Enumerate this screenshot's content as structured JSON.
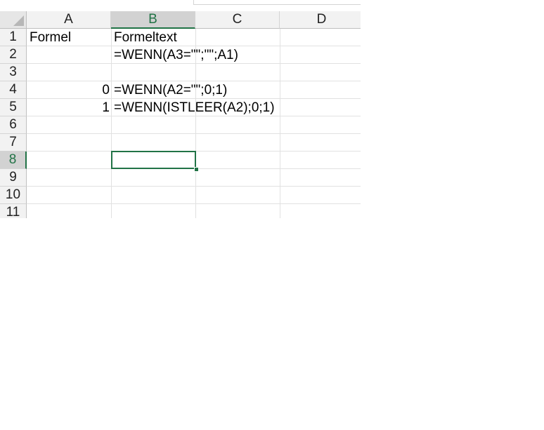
{
  "columns": [
    "A",
    "B",
    "C",
    "D"
  ],
  "rows": [
    "1",
    "2",
    "3",
    "4",
    "5",
    "6",
    "7",
    "8",
    "9",
    "10",
    "11"
  ],
  "active_cell": {
    "column": "B",
    "row": "8"
  },
  "cells": {
    "a1": "Formel",
    "b1": "Formeltext",
    "b2": "=WENN(A3=\"\";\"\";A1)",
    "a4": "0",
    "b4": "=WENN(A2=\"\";0;1)",
    "a5": "1",
    "b5": "=WENN(ISTLEER(A2);0;1)"
  },
  "colors": {
    "accent": "#217346",
    "header_bg": "#f2f2f2",
    "gridline": "#e1e1e1"
  }
}
